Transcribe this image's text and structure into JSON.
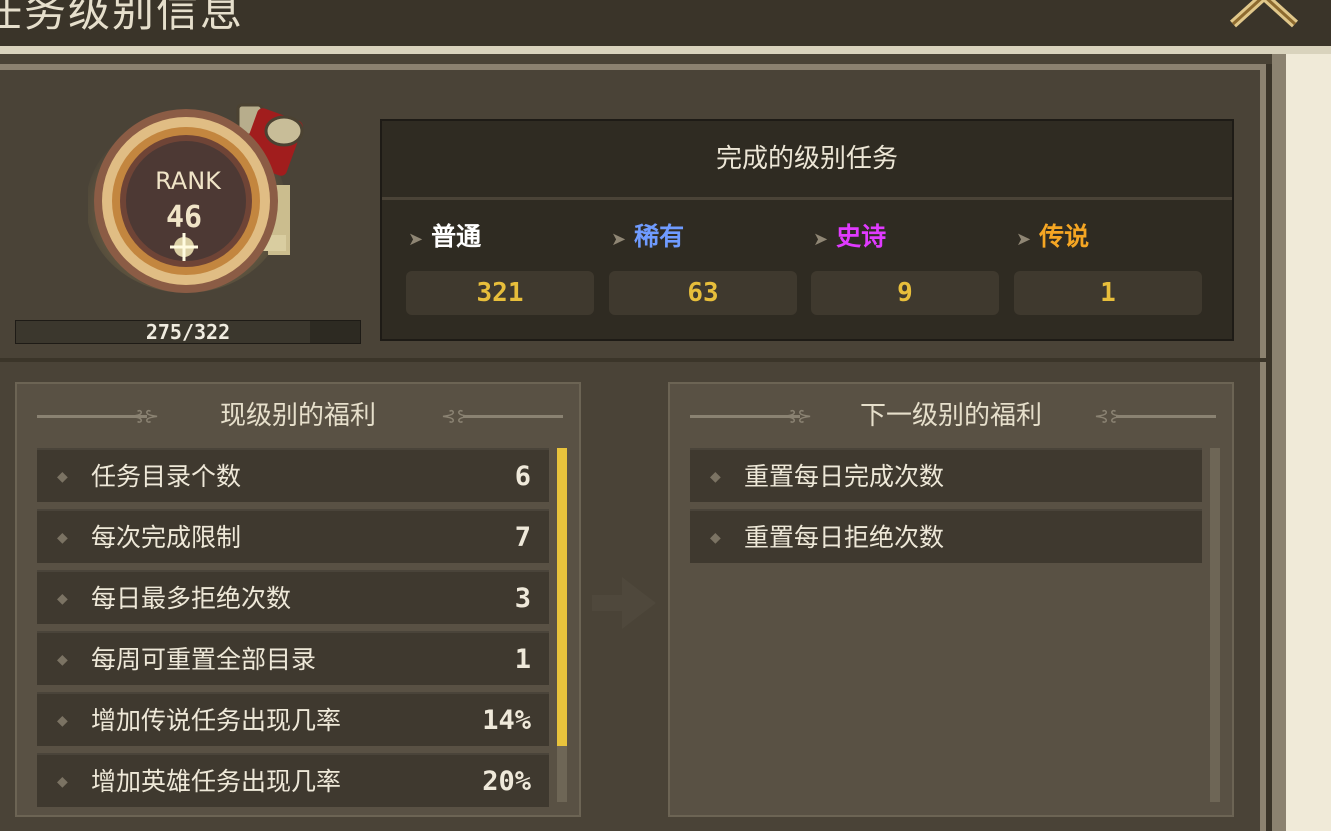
{
  "header": {
    "title": "任务级别信息",
    "close_icon": "chevron-up-icon"
  },
  "rank": {
    "label": "RANK",
    "level": "46",
    "progress_text": "275/322",
    "progress": 0.854
  },
  "completed": {
    "title": "完成的级别任务",
    "categories": [
      {
        "name": "普通",
        "count": "321",
        "color": "#ffffff"
      },
      {
        "name": "稀有",
        "count": "63",
        "color": "#6f9bff"
      },
      {
        "name": "史诗",
        "count": "9",
        "color": "#e03aff"
      },
      {
        "name": "传说",
        "count": "1",
        "color": "#f5a623"
      }
    ]
  },
  "current_benefits": {
    "title": "现级别的福利",
    "items": [
      {
        "label": "任务目录个数",
        "value": "6"
      },
      {
        "label": "每次完成限制",
        "value": "7"
      },
      {
        "label": "每日最多拒绝次数",
        "value": "3"
      },
      {
        "label": "每周可重置全部目录",
        "value": "1"
      },
      {
        "label": "增加传说任务出现几率",
        "value": "14%"
      },
      {
        "label": "增加英雄任务出现几率",
        "value": "20%"
      }
    ]
  },
  "next_benefits": {
    "title": "下一级别的福利",
    "items": [
      {
        "label": "重置每日完成次数"
      },
      {
        "label": "重置每日拒绝次数"
      }
    ]
  },
  "colors": {
    "accent_gold": "#e7be3b",
    "panel": "#4a4337"
  }
}
